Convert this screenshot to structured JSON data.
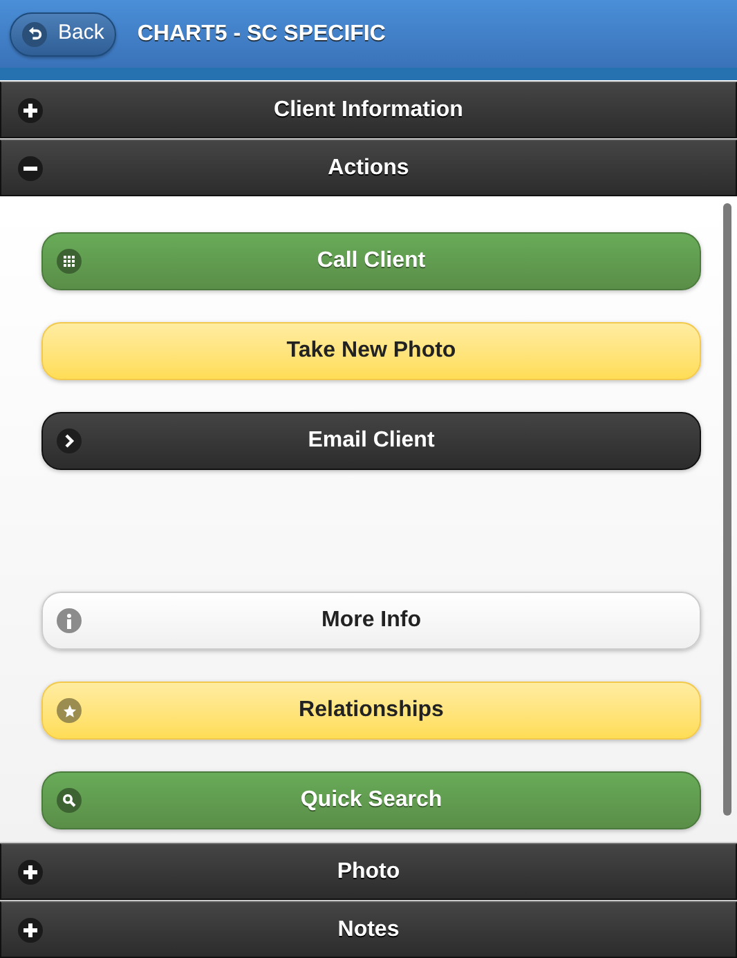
{
  "header": {
    "back_label": "Back",
    "title": "CHART5 - SC SPECIFIC"
  },
  "sections_top": [
    {
      "title": "Client Information",
      "expanded": false
    },
    {
      "title": "Actions",
      "expanded": true
    }
  ],
  "action_groups": [
    [
      {
        "label": "Call Client",
        "kind": "dial"
      },
      {
        "label": "Take New Photo",
        "kind": "plain"
      },
      {
        "label": "Email Client",
        "kind": "next"
      }
    ],
    [
      {
        "label": "More Info",
        "kind": "info"
      },
      {
        "label": "Relationships",
        "kind": "favorite"
      },
      {
        "label": "Quick Search",
        "kind": "search"
      }
    ]
  ],
  "sections_bottom": [
    {
      "title": "Photo",
      "expanded": false
    },
    {
      "title": "Notes",
      "expanded": false
    }
  ]
}
